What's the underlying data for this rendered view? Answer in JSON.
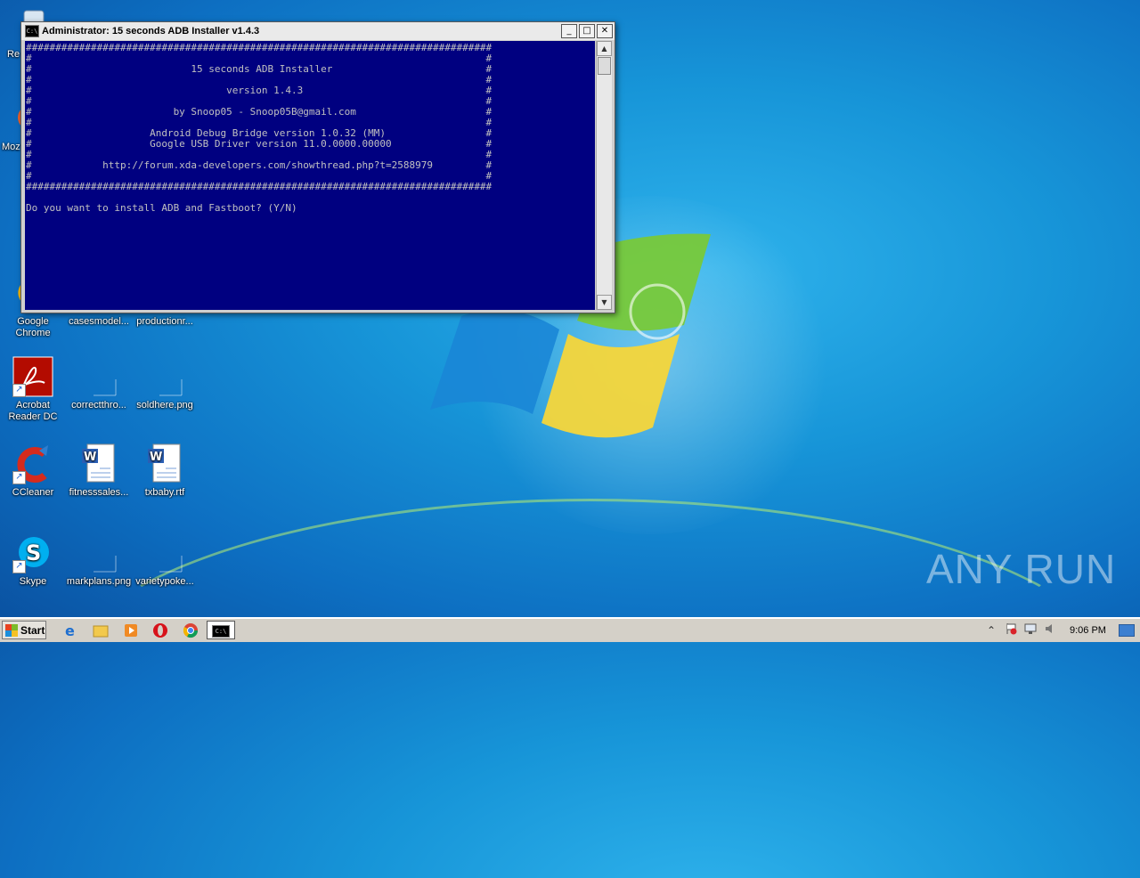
{
  "window": {
    "title": "Administrator:  15 seconds ADB Installer v1.4.3",
    "icon": "cmd-icon",
    "controls": {
      "minimize": "_",
      "maximize": "□",
      "close": "✕"
    }
  },
  "console": {
    "lines": [
      "###############################################################################",
      "#                                                                             #",
      "#                           15 seconds ADB Installer                          #",
      "#                                                                             #",
      "#                                 version 1.4.3                               #",
      "#                                                                             #",
      "#                        by Snoop05 - Snoop05B@gmail.com                      #",
      "#                                                                             #",
      "#                    Android Debug Bridge version 1.0.32 (MM)                 #",
      "#                    Google USB Driver version 11.0.0000.00000                #",
      "#                                                                             #",
      "#            http://forum.xda-developers.com/showthread.php?t=2588979         #",
      "#                                                                             #",
      "###############################################################################",
      "",
      "Do you want to install ADB and Fastboot? (Y/N)"
    ]
  },
  "desktop_icons": [
    {
      "id": "recycle",
      "label": "Re",
      "icon": "recycle-bin-icon"
    },
    {
      "id": "mozilla",
      "label": "Moz",
      "icon": "firefox-icon"
    },
    {
      "id": "chrome",
      "label": "Google Chrome",
      "icon": "chrome-icon"
    },
    {
      "id": "casesmodel",
      "label": "casesmodel...",
      "icon": "file-icon"
    },
    {
      "id": "productionr",
      "label": "productionr...",
      "icon": "file-icon"
    },
    {
      "id": "acrobat",
      "label": "Acrobat Reader DC",
      "icon": "acrobat-icon"
    },
    {
      "id": "correctthro",
      "label": "correctthro...",
      "icon": "file-icon"
    },
    {
      "id": "soldhere",
      "label": "soldhere.png",
      "icon": "image-file-icon"
    },
    {
      "id": "ccleaner",
      "label": "CCleaner",
      "icon": "ccleaner-icon"
    },
    {
      "id": "fitnesssales",
      "label": "fitnesssales...",
      "icon": "word-doc-icon"
    },
    {
      "id": "txbaby",
      "label": "txbaby.rtf",
      "icon": "word-doc-icon"
    },
    {
      "id": "skype",
      "label": "Skype",
      "icon": "skype-icon"
    },
    {
      "id": "markplans",
      "label": "markplans.png",
      "icon": "image-file-icon"
    },
    {
      "id": "varietypoke",
      "label": "varietypoke...",
      "icon": "image-file-icon"
    }
  ],
  "taskbar": {
    "start_label": "Start",
    "pinned": [
      "ie-icon",
      "explorer-icon",
      "media-player-icon",
      "opera-icon",
      "chrome-icon",
      "cmd-icon"
    ],
    "clock": "9:06 PM"
  },
  "watermark": {
    "text": "ANY RUN"
  },
  "colors": {
    "console_bg": "#000080",
    "console_fg": "#c0c0c0",
    "taskbar": "#d4d0c8"
  }
}
